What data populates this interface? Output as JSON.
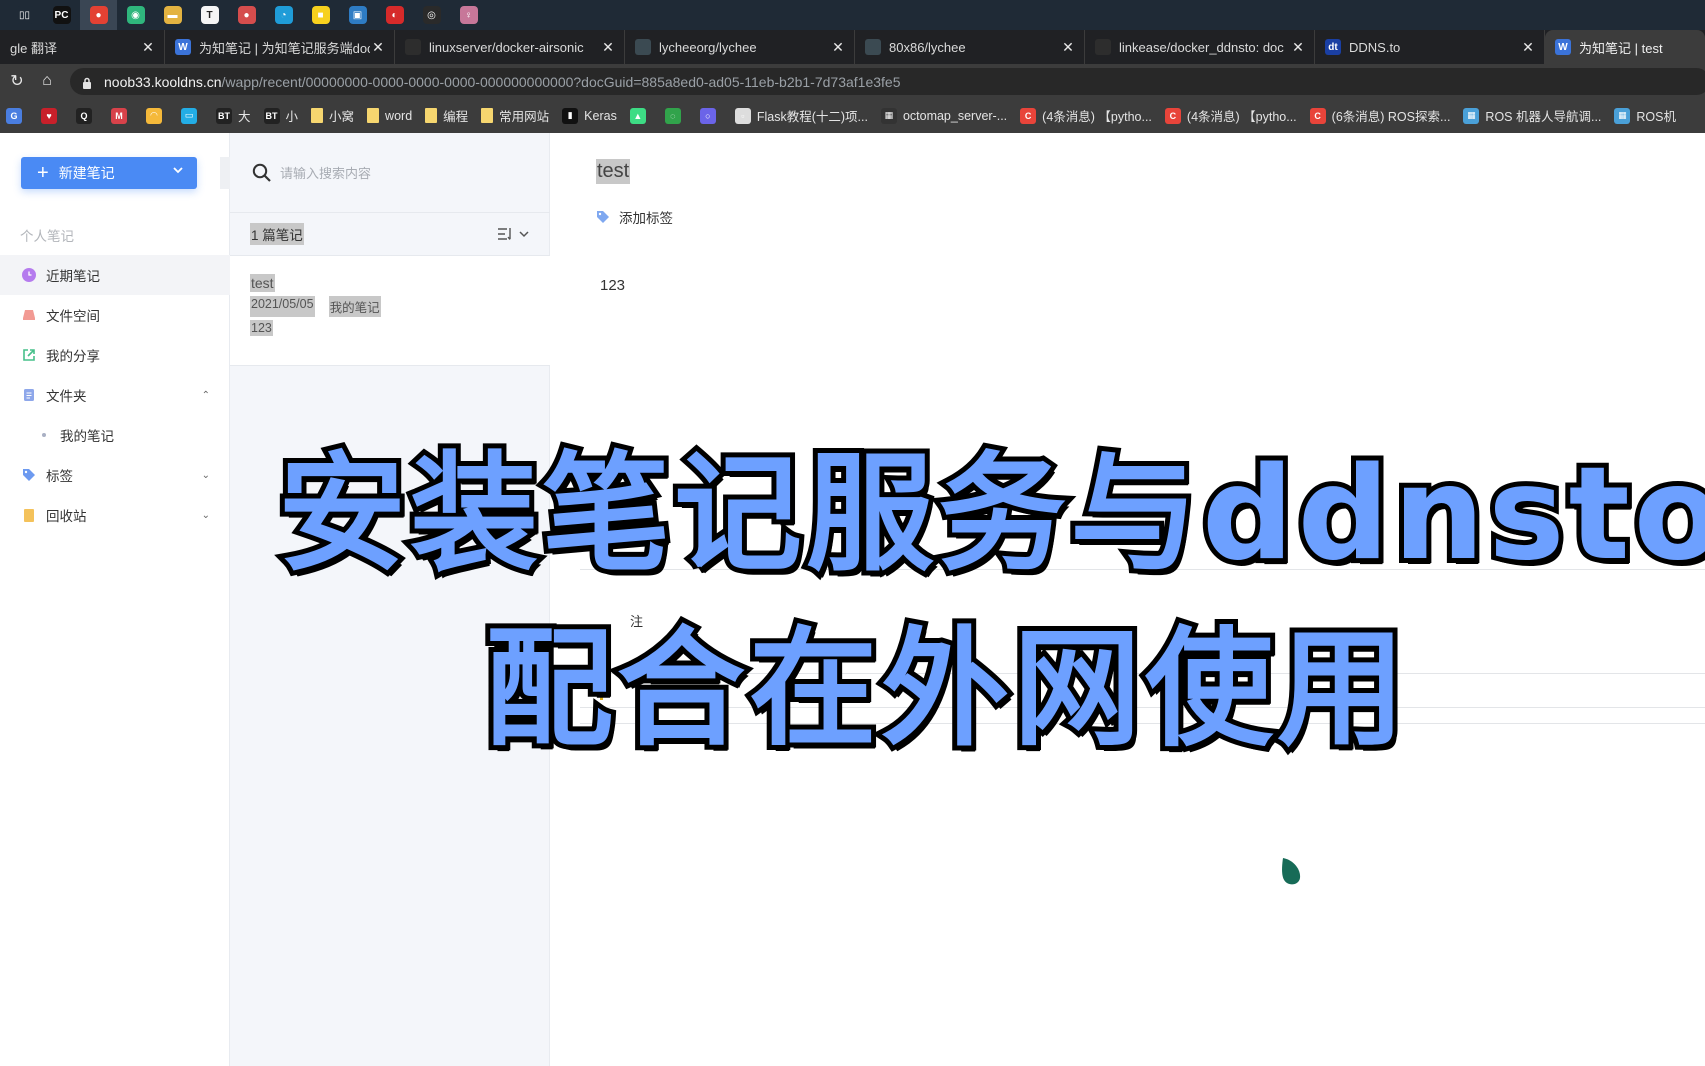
{
  "taskbar": {
    "icons": [
      {
        "name": "task-view",
        "glyph": "▯▯",
        "color": "#1f2a36"
      },
      {
        "name": "pycharm",
        "glyph": "PC",
        "color": "#111"
      },
      {
        "name": "chrome",
        "glyph": "●",
        "color": "#e34133"
      },
      {
        "name": "app-green",
        "glyph": "◉",
        "color": "#2fb67d"
      },
      {
        "name": "file-explorer",
        "glyph": "▬",
        "color": "#e3b341"
      },
      {
        "name": "typora",
        "glyph": "T",
        "color": "#f5f5f5"
      },
      {
        "name": "chrome-profile",
        "glyph": "●",
        "color": "#d54d4d"
      },
      {
        "name": "edge",
        "glyph": "◔",
        "color": "#1f9cd8"
      },
      {
        "name": "sticky-notes",
        "glyph": "■",
        "color": "#f7d11e"
      },
      {
        "name": "virtualbox",
        "glyph": "▣",
        "color": "#2e7cc4"
      },
      {
        "name": "netease-music",
        "glyph": "◐",
        "color": "#d62a2a"
      },
      {
        "name": "obs",
        "glyph": "◎",
        "color": "#2a2a2a"
      },
      {
        "name": "avatar-app",
        "glyph": "♀",
        "color": "#c77799"
      }
    ]
  },
  "tabs": [
    {
      "title": "gle 翻译",
      "favicon": "",
      "fav_color": "transparent",
      "active": false
    },
    {
      "title": "为知笔记 | 为知笔记服务端doc",
      "favicon": "W",
      "fav_color": "#3b73d9",
      "active": false
    },
    {
      "title": "linuxserver/docker-airsonic",
      "favicon": "",
      "fav_color": "#2d2d2d",
      "active": false
    },
    {
      "title": "lycheeorg/lychee",
      "favicon": "",
      "fav_color": "#3b4a52",
      "active": false
    },
    {
      "title": "80x86/lychee",
      "favicon": "",
      "fav_color": "#3b4a52",
      "active": false
    },
    {
      "title": "linkease/docker_ddnsto: doc",
      "favicon": "",
      "fav_color": "#2d2d2d",
      "active": false
    },
    {
      "title": "DDNS.to",
      "favicon": "dt",
      "fav_color": "#1a3fa3",
      "active": false
    },
    {
      "title": "为知笔记 | test",
      "favicon": "W",
      "fav_color": "#3b73d9",
      "active": true
    }
  ],
  "toolbar": {
    "reload_icon": "↻",
    "home_icon": "⌂",
    "url_host": "noob33.kooldns.cn",
    "url_path": "/wapp/recent/00000000-0000-0000-0000-000000000000?docGuid=885a8ed0-ad05-11eb-b2b1-7d73af1e3fe5"
  },
  "bookmarks": [
    {
      "label": "",
      "icon": "G",
      "color": "#4a7ee0"
    },
    {
      "label": "",
      "icon": "♥",
      "color": "#c8202a"
    },
    {
      "label": "",
      "icon": "Q",
      "color": "#222"
    },
    {
      "label": "",
      "icon": "M",
      "color": "#d8424a"
    },
    {
      "label": "",
      "icon": "◠",
      "color": "#f5b93a"
    },
    {
      "label": "",
      "icon": "▭",
      "color": "#23ade5"
    },
    {
      "label": "大",
      "icon": "BT",
      "color": "#222"
    },
    {
      "label": "小",
      "icon": "BT",
      "color": "#222"
    },
    {
      "label": "小窝",
      "icon": "folder",
      "color": "#f6d66f"
    },
    {
      "label": "word",
      "icon": "folder",
      "color": "#f6d66f"
    },
    {
      "label": "编程",
      "icon": "folder",
      "color": "#f6d66f"
    },
    {
      "label": "常用网站",
      "icon": "folder",
      "color": "#f6d66f"
    },
    {
      "label": "Keras",
      "icon": "▮",
      "color": "#111"
    },
    {
      "label": "",
      "icon": "▲",
      "color": "#3ddc84"
    },
    {
      "label": "",
      "icon": "◌",
      "color": "#31a34b"
    },
    {
      "label": "",
      "icon": "○",
      "color": "#6b64e8"
    },
    {
      "label": "Flask教程(十二)项...",
      "icon": "▫",
      "color": "#ddd"
    },
    {
      "label": "octomap_server-...",
      "icon": "▦",
      "color": "#333"
    },
    {
      "label": "(4条消息) 【pytho...",
      "icon": "C",
      "color": "#e8443a"
    },
    {
      "label": "(4条消息) 【pytho...",
      "icon": "C",
      "color": "#e8443a"
    },
    {
      "label": "(6条消息) ROS探索...",
      "icon": "C",
      "color": "#e8443a"
    },
    {
      "label": "ROS 机器人导航调...",
      "icon": "▦",
      "color": "#4aa0d8"
    },
    {
      "label": "ROS机",
      "icon": "▦",
      "color": "#4aa0d8"
    }
  ],
  "sidebar": {
    "new_note_label": "新建笔记",
    "section_label": "个人笔记",
    "items": [
      {
        "label": "近期笔记",
        "icon": "clock-icon",
        "color": "#b57bee",
        "active": true,
        "chevron": ""
      },
      {
        "label": "文件空间",
        "icon": "inbox-icon",
        "color": "#f29a93",
        "active": false,
        "chevron": ""
      },
      {
        "label": "我的分享",
        "icon": "share-icon",
        "color": "#47c08a",
        "active": false,
        "chevron": ""
      },
      {
        "label": "文件夹",
        "icon": "folder-icon",
        "color": "#8ea7ea",
        "active": false,
        "chevron": "⌃"
      },
      {
        "label": "标签",
        "icon": "tag-icon",
        "color": "#6d9af0",
        "active": false,
        "chevron": "⌄"
      },
      {
        "label": "回收站",
        "icon": "trash-icon",
        "color": "#f4c25b",
        "active": false,
        "chevron": "⌄"
      }
    ],
    "sub_items": [
      {
        "label": "我的笔记"
      }
    ]
  },
  "note_list": {
    "search_placeholder": "请输入搜索内容",
    "count_label": "1 篇笔记",
    "sort_icon": "☰↓",
    "notes": [
      {
        "title": "test",
        "date": "2021/05/05",
        "folder": "我的笔记",
        "preview": "123"
      }
    ]
  },
  "editor": {
    "title": "test",
    "add_tag_label": "添加标签",
    "body": "123",
    "comment_label": "注"
  },
  "overlay": {
    "line1": "安装笔记服务与ddnsto",
    "line2": "配合在外网使用",
    "fill_color": "#6da0ff"
  }
}
